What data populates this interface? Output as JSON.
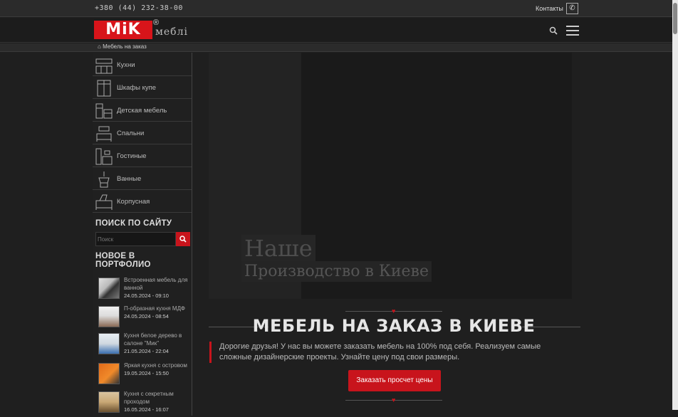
{
  "topbar": {
    "phone": "+380 (44) 232-38-00",
    "contacts_label": "Контакты",
    "phone_icon": "phone-icon"
  },
  "header": {
    "logo_text": "MiK",
    "logo_reg": "®",
    "logo_sub": "меблі",
    "search_icon": "search-icon",
    "menu_icon": "hamburger-icon"
  },
  "breadcrumb": {
    "label": "Мебель на заказ",
    "icon": "home-icon"
  },
  "sidebar": {
    "categories": [
      {
        "label": "Кухни",
        "icon": "kitchen-icon"
      },
      {
        "label": "Шкафы купе",
        "icon": "wardrobe-icon"
      },
      {
        "label": "Детская мебель",
        "icon": "kids-furniture-icon"
      },
      {
        "label": "Спальни",
        "icon": "bed-icon"
      },
      {
        "label": "Гостиные",
        "icon": "living-room-icon"
      },
      {
        "label": "Ванные",
        "icon": "bathroom-icon"
      },
      {
        "label": "Корпусная",
        "icon": "cabinet-icon"
      }
    ],
    "search_title": "ПОИСК ПО САЙТУ",
    "search_placeholder": "Поиск",
    "portfolio_title": "НОВОЕ В ПОРТФОЛИО",
    "portfolio": [
      {
        "title": "Встроенная мебель для ванной",
        "date": "24.05.2024 - 09:10"
      },
      {
        "title": "П-образная кухня МДФ",
        "date": "24.05.2024 - 08:54"
      },
      {
        "title": "Кухня белое дерево в салоне \"Мик\"",
        "date": "21.05.2024 - 22:04"
      },
      {
        "title": "Яркая кухня с островом",
        "date": "19.05.2024 - 15:50"
      },
      {
        "title": "Кухня с секретным проходом",
        "date": "16.05.2024 - 16:07"
      }
    ]
  },
  "main": {
    "slide_line1": "Наше",
    "slide_line2": "Производство в Киеве",
    "title": "МЕБЕЛЬ НА ЗАКАЗ В КИЕВЕ",
    "intro": "Дорогие друзья! У нас вы можете заказать мебель на 100% под себя. Реализуем самые сложные дизайнерские проекты. Узнайте цену под свои размеры.",
    "cta_label": "Заказать просчет цены"
  },
  "colors": {
    "accent": "#c8141c",
    "logo": "#d8141a",
    "background": "#1f1f1f"
  }
}
